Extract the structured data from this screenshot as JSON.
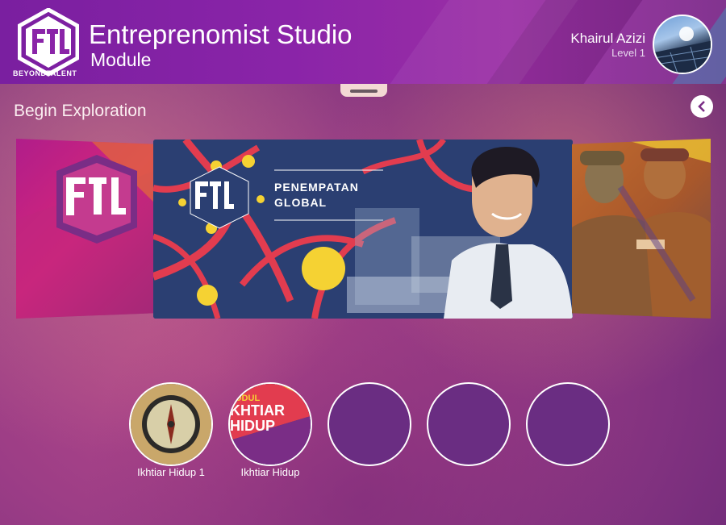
{
  "header": {
    "logo_brand": "BEYONDTALENT",
    "title": "Entreprenomist Studio",
    "subtitle": "Module",
    "user": {
      "name": "Khairul Azizi",
      "level": "Level 1"
    }
  },
  "section": {
    "title": "Begin Exploration"
  },
  "carousel": {
    "cards": [
      {
        "name": "left-card"
      },
      {
        "name": "main-card",
        "title_line1": "PENEMPATAN",
        "title_line2": "GLOBAL"
      },
      {
        "name": "right-card"
      }
    ]
  },
  "modules": [
    {
      "label": "Ikhtiar Hidup 1",
      "thumb": "compass"
    },
    {
      "label": "Ikhtiar Hidup",
      "thumb": "modul-ikhtiar",
      "thumb_text_1": "ODUL",
      "thumb_text_2": "KHTIAR",
      "thumb_text_3": "HIDUP"
    },
    {
      "label": "",
      "thumb": "empty"
    },
    {
      "label": "",
      "thumb": "empty"
    },
    {
      "label": "",
      "thumb": "empty"
    }
  ],
  "colors": {
    "header": "#8a24a8",
    "accent_red": "#e23c4f",
    "accent_yellow": "#f5d233",
    "card_navy": "#2b3f72"
  }
}
